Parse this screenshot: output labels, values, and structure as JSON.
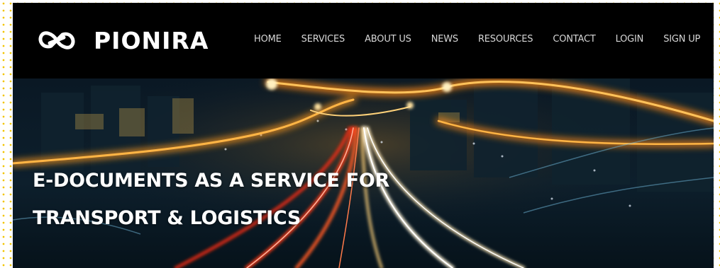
{
  "brand": {
    "name": "PIONIRA",
    "logo_icon": "infinity-link-icon",
    "text_color": "#ffffff"
  },
  "nav": {
    "items": [
      {
        "label": "HOME"
      },
      {
        "label": "SERVICES"
      },
      {
        "label": "ABOUT US"
      },
      {
        "label": "NEWS"
      },
      {
        "label": "RESOURCES"
      },
      {
        "label": "CONTACT"
      },
      {
        "label": "LOGIN"
      },
      {
        "label": "SIGN UP"
      }
    ],
    "text_color": "#d6d6d6",
    "background": "#000000"
  },
  "hero": {
    "headline_line1": "E-DOCUMENTS AS A SERVICE FOR",
    "headline_line2": "TRANSPORT & LOGISTICS",
    "image": "night-city-highway-light-trails",
    "accent_colors": [
      "#ff9a1f",
      "#ff3b1a",
      "#ffd27a"
    ]
  },
  "page": {
    "border_pattern": "yellow-dotted",
    "border_color": "#f2c400"
  }
}
